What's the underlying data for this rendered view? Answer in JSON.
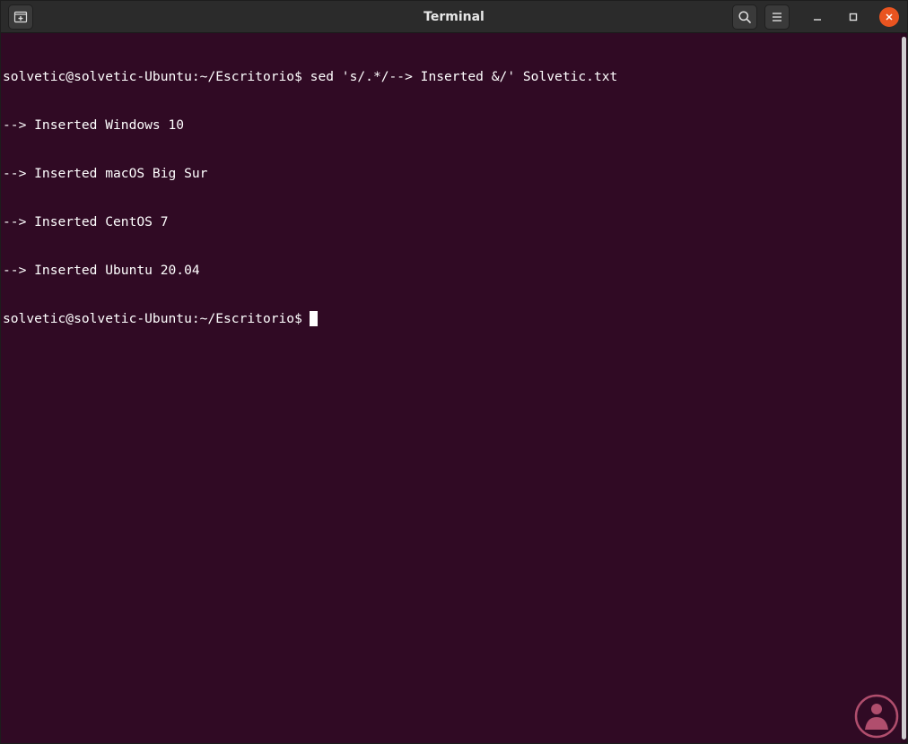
{
  "window": {
    "title": "Terminal"
  },
  "titlebar": {
    "icons": {
      "new_tab": "new-tab-icon",
      "search": "search-icon",
      "menu": "hamburger-menu-icon",
      "minimize": "minimize-icon",
      "maximize": "maximize-icon",
      "close": "close-icon"
    },
    "close_color": "#e95420"
  },
  "terminal": {
    "background": "#300a24",
    "lines": [
      {
        "prompt": "solvetic@solvetic-Ubuntu:~/Escritorio$",
        "text": " sed 's/.*/--> Inserted &/' Solvetic.txt"
      },
      {
        "prompt": "",
        "text": "--> Inserted Windows 10"
      },
      {
        "prompt": "",
        "text": "--> Inserted macOS Big Sur"
      },
      {
        "prompt": "",
        "text": "--> Inserted CentOS 7"
      },
      {
        "prompt": "",
        "text": "--> Inserted Ubuntu 20.04"
      },
      {
        "prompt": "solvetic@solvetic-Ubuntu:~/Escritorio$",
        "text": "",
        "cursor": true
      }
    ]
  },
  "watermark": {
    "icon": "solvetic-logo-icon",
    "color": "#c75b7a"
  }
}
